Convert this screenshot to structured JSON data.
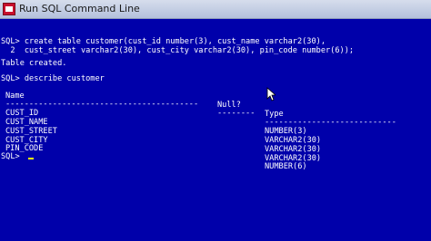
{
  "window": {
    "title": "Run SQL Command Line",
    "icon": "sqlplus-app-icon"
  },
  "console": {
    "lines": [
      "SQL> create table customer(cust_id number(3), cust_name varchar2(30),",
      "  2  cust_street varchar2(30), cust_city varchar2(30), pin_code number(6));",
      "",
      "Table created.",
      "",
      "SQL> describe customer"
    ],
    "describe": {
      "headers": {
        "name": "Name",
        "null": "Null?",
        "type": "Type"
      },
      "separators": {
        "name": "-----------------------------------------",
        "null": "--------",
        "type": "----------------------------"
      },
      "rows": [
        {
          "name": "CUST_ID",
          "null": "",
          "type": "NUMBER(3)"
        },
        {
          "name": "CUST_NAME",
          "null": "",
          "type": "VARCHAR2(30)"
        },
        {
          "name": "CUST_STREET",
          "null": "",
          "type": "VARCHAR2(30)"
        },
        {
          "name": "CUST_CITY",
          "null": "",
          "type": "VARCHAR2(30)"
        },
        {
          "name": "PIN_CODE",
          "null": "",
          "type": "NUMBER(6)"
        }
      ]
    },
    "prompt": "SQL>"
  },
  "colors": {
    "background": "#0000aa",
    "text": "#ffffff",
    "cursor": "#ffff00"
  }
}
